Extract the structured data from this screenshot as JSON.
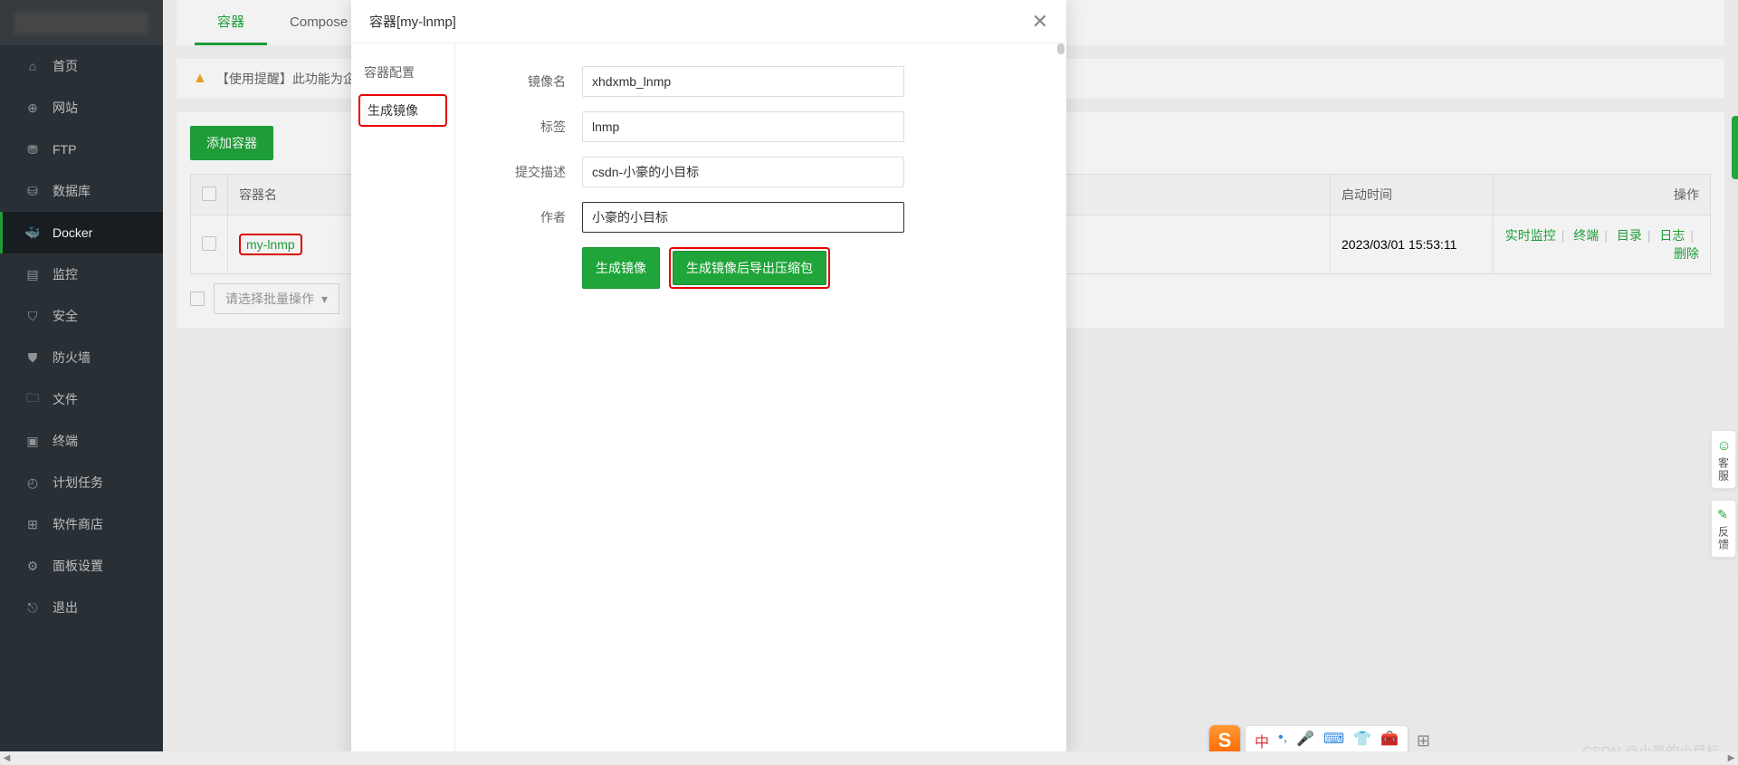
{
  "sidebar": {
    "items": [
      {
        "label": "首页",
        "icon": "home"
      },
      {
        "label": "网站",
        "icon": "globe"
      },
      {
        "label": "FTP",
        "icon": "ftp"
      },
      {
        "label": "数据库",
        "icon": "db"
      },
      {
        "label": "Docker",
        "icon": "docker"
      },
      {
        "label": "监控",
        "icon": "monitor"
      },
      {
        "label": "安全",
        "icon": "shield"
      },
      {
        "label": "防火墙",
        "icon": "fire"
      },
      {
        "label": "文件",
        "icon": "folder"
      },
      {
        "label": "终端",
        "icon": "term"
      },
      {
        "label": "计划任务",
        "icon": "task"
      },
      {
        "label": "软件商店",
        "icon": "store"
      },
      {
        "label": "面板设置",
        "icon": "panel"
      },
      {
        "label": "退出",
        "icon": "exit"
      }
    ]
  },
  "tabs": {
    "container": "容器",
    "compose": "Compose"
  },
  "alert": "【使用提醒】此功能为企业版",
  "buttons": {
    "add_container": "添加容器"
  },
  "table": {
    "col_name": "容器名",
    "col_start_time": "启动时间",
    "col_action": "操作",
    "row0": {
      "name": "my-lnmp",
      "start_time": "2023/03/01 15:53:11",
      "actions": {
        "monitor": "实时监控",
        "terminal": "终端",
        "dir": "目录",
        "log": "日志",
        "delete": "删除"
      }
    }
  },
  "batch": {
    "placeholder": "请选择批量操作"
  },
  "modal": {
    "title": "容器[my-lnmp]",
    "close": "✕",
    "tab_config": "容器配置",
    "tab_image": "生成镜像",
    "form": {
      "image_name_label": "镜像名",
      "image_name_value": "xhdxmb_lnmp",
      "tag_label": "标签",
      "tag_value": "lnmp",
      "desc_label": "提交描述",
      "desc_value": "csdn-小豪的小目标",
      "author_label": "作者",
      "author_value": "小豪的小目标",
      "btn_generate": "生成镜像",
      "btn_export": "生成镜像后导出压缩包"
    }
  },
  "float": {
    "service": "客服",
    "feedback": "反馈"
  },
  "ime": {
    "zhong": "中"
  },
  "watermark": "CSDN @小豪的小目标"
}
